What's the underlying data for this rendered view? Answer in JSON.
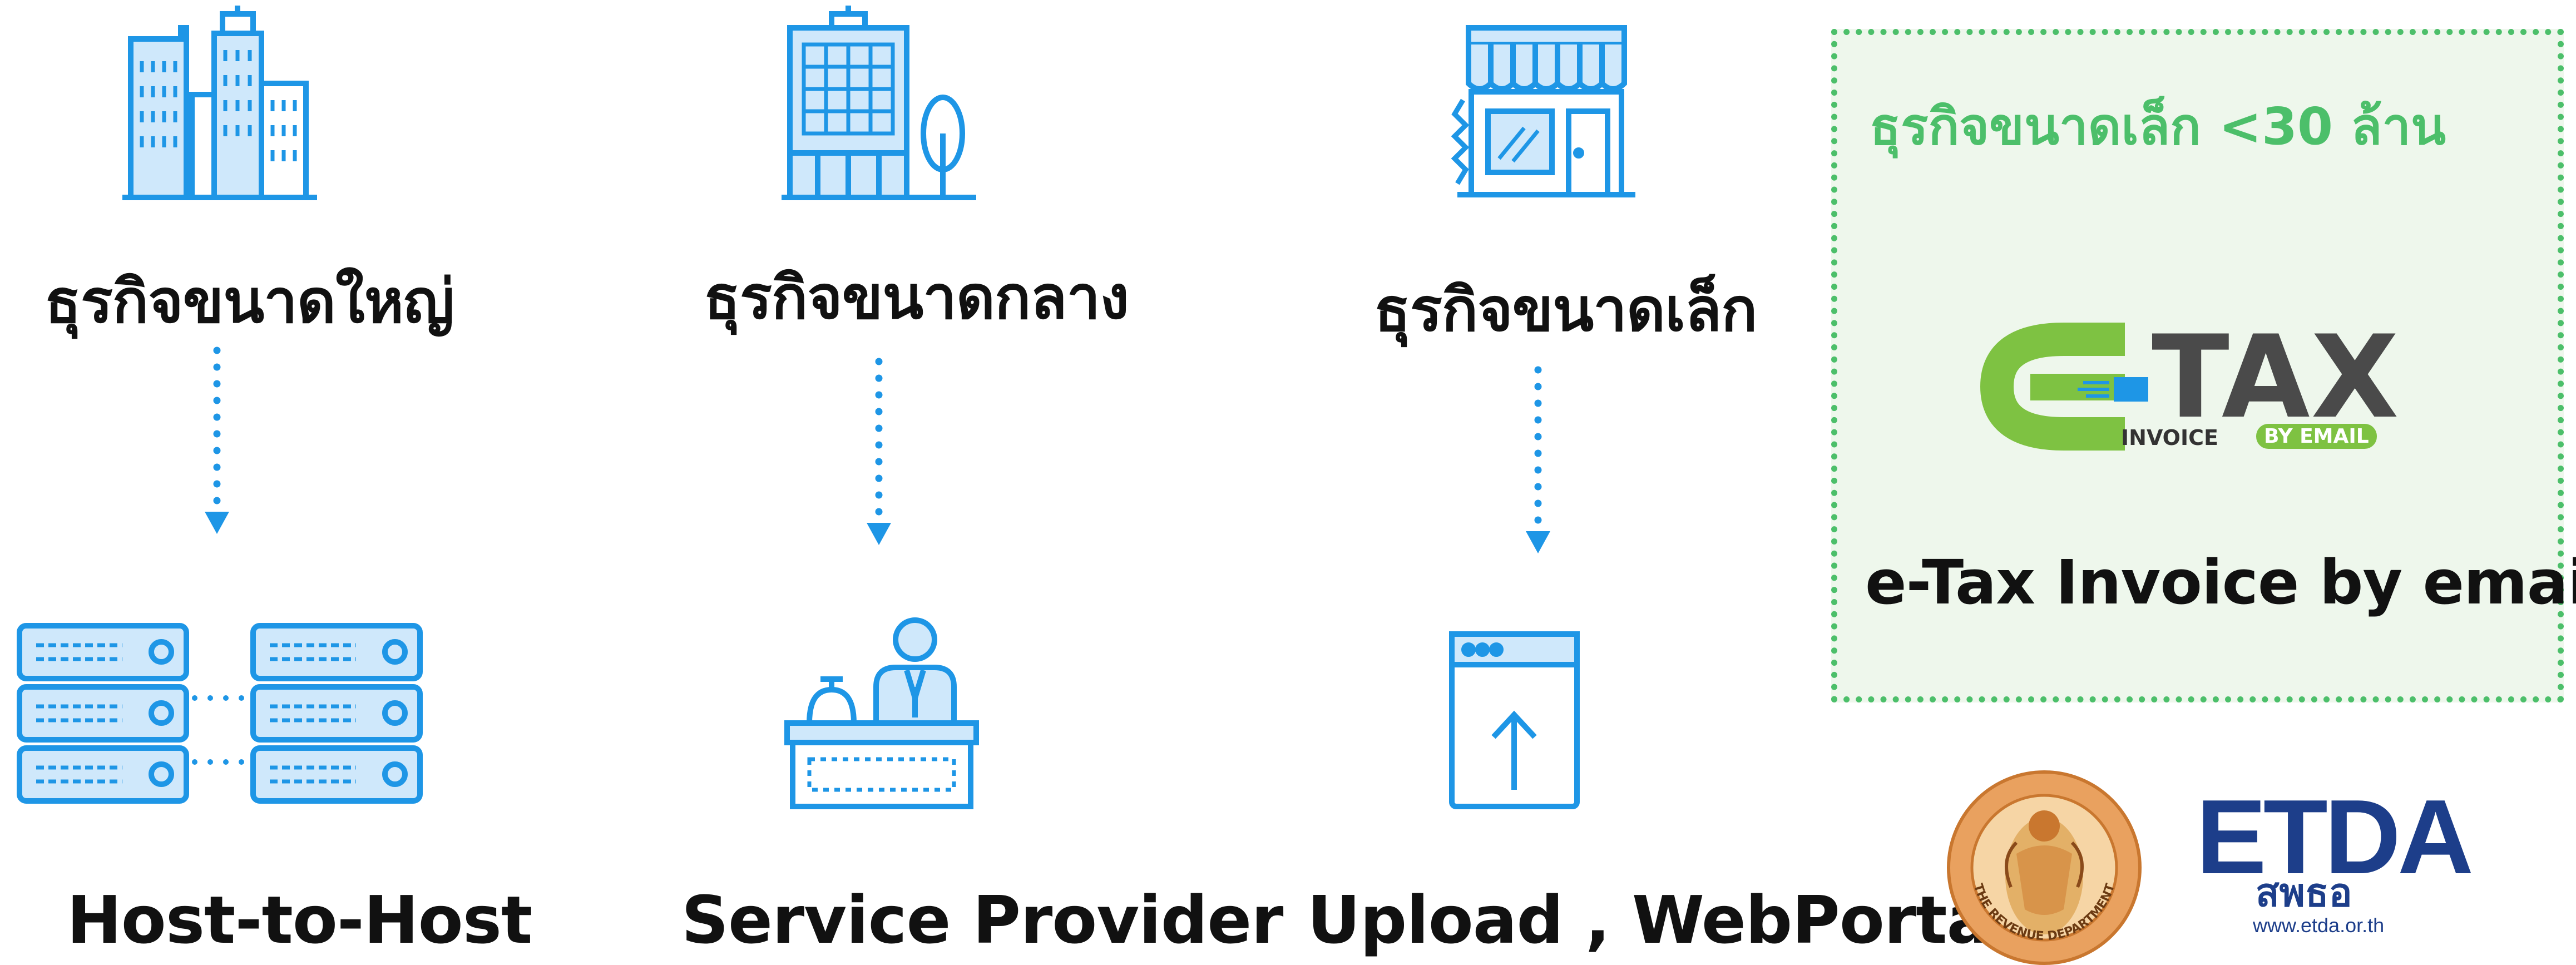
{
  "colors": {
    "icon_blue": "#1e96e6",
    "panel_green": "#4cbf6a",
    "panel_bg": "#eef7ec",
    "etda_navy": "#1d3e8a",
    "etax_green": "#7ec242"
  },
  "columns": [
    {
      "category_label": "ธุรกิจขนาดใหญ่",
      "category_icon": "city-buildings-icon",
      "method_label": "Host-to-Host",
      "method_icon": "server-racks-icon"
    },
    {
      "category_label": "ธุรกิจขนาดกลาง",
      "category_icon": "office-building-tree-icon",
      "method_label": "Service Provider",
      "method_icon": "reception-desk-icon"
    },
    {
      "category_label": "ธุรกิจขนาดเล็ก",
      "category_icon": "shop-storefront-icon",
      "method_label": "Upload , WebPortal",
      "method_icon": "upload-window-icon"
    }
  ],
  "panel": {
    "title": "ธุรกิจขนาดเล็ก <30 ล้าน",
    "logo": {
      "brand": "TAX",
      "sub_left": "INVOICE",
      "sub_right": "BY EMAIL",
      "icon": "etax-logo-icon"
    },
    "caption": "e-Tax Invoice by email"
  },
  "logos": {
    "revenue_department": {
      "icon": "revenue-department-seal-icon",
      "text": "THE REVENUE DEPARTMENT"
    },
    "etda": {
      "name": "ETDA",
      "thai": "สพธอ",
      "url": "www.etda.or.th",
      "icon": "etda-logo-icon"
    }
  }
}
